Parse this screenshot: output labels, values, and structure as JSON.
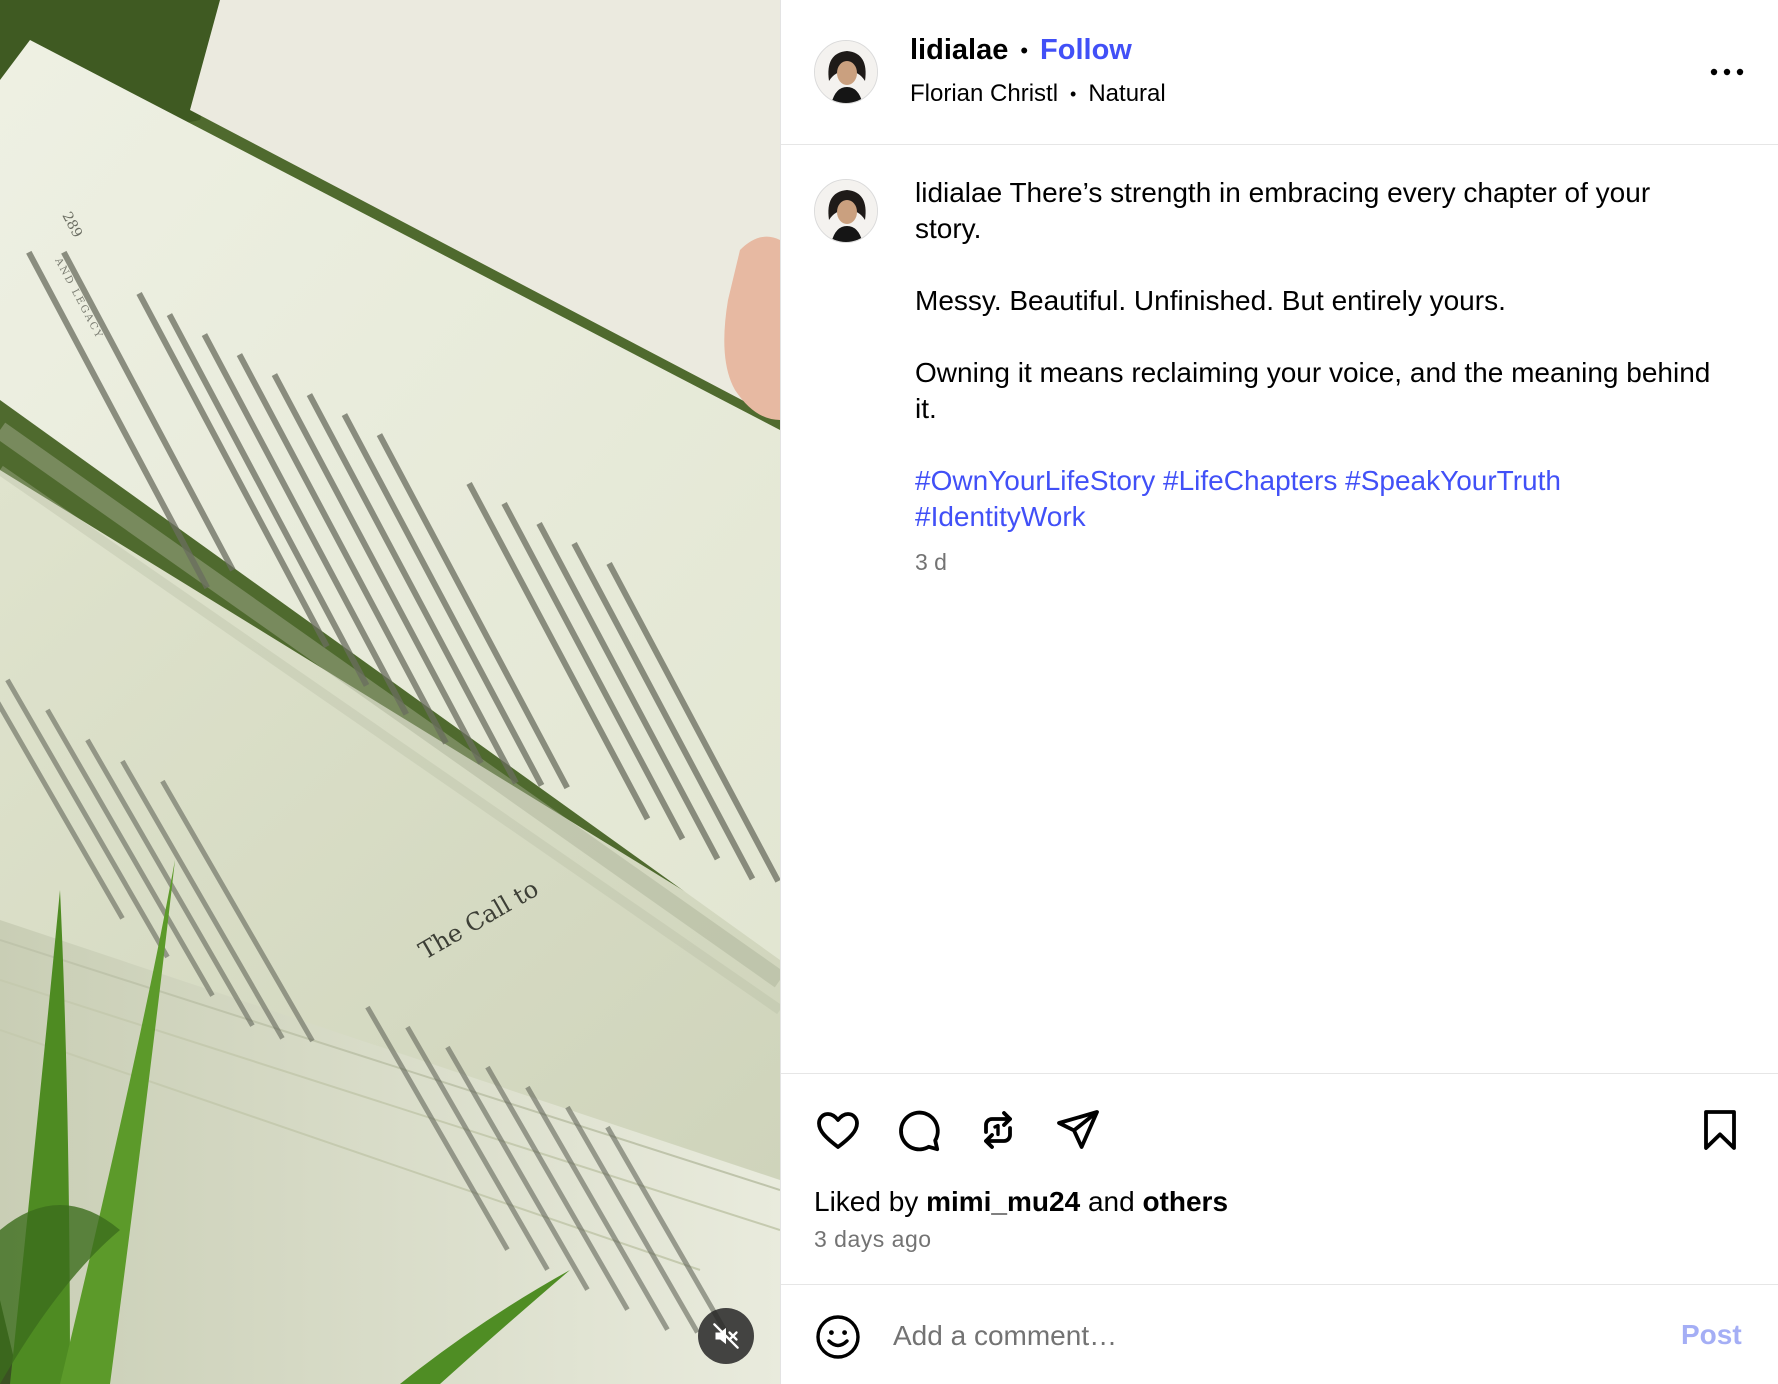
{
  "post": {
    "username": "lidialae",
    "follow_label": "Follow",
    "audio_credit": "Florian Christl",
    "audio_title": "Natural",
    "more_icon": "more-horizontal-icon"
  },
  "caption": {
    "username": "lidialae",
    "line1": "There’s strength in embracing every chapter of your story.",
    "line2": "Messy. Beautiful. Unfinished. But entirely yours.",
    "line3": "Owning it means reclaiming your voice, and the meaning behind it.",
    "hashtags": [
      "#OwnYourLifeStory",
      "#LifeChapters",
      "#SpeakYourTruth",
      "#IdentityWork"
    ],
    "time": "3 d"
  },
  "actions": {
    "icons": [
      "heart-icon",
      "comment-icon",
      "repost-icon",
      "share-icon",
      "bookmark-icon"
    ]
  },
  "likes": {
    "prefix": "Liked by",
    "first_user": "mimi_mu24",
    "joiner": "and",
    "others": "others"
  },
  "posted_ago": "3 days ago",
  "comment": {
    "placeholder": "Add a comment…",
    "post_label": "Post"
  },
  "media": {
    "book_page_text": {
      "page_number": "289",
      "running_head": "AND LEGACY",
      "chapter_heading": "The Call to"
    }
  },
  "colors": {
    "link": "#4150f7",
    "secondary_text": "#737373",
    "post_disabled": "#a4aef5"
  }
}
